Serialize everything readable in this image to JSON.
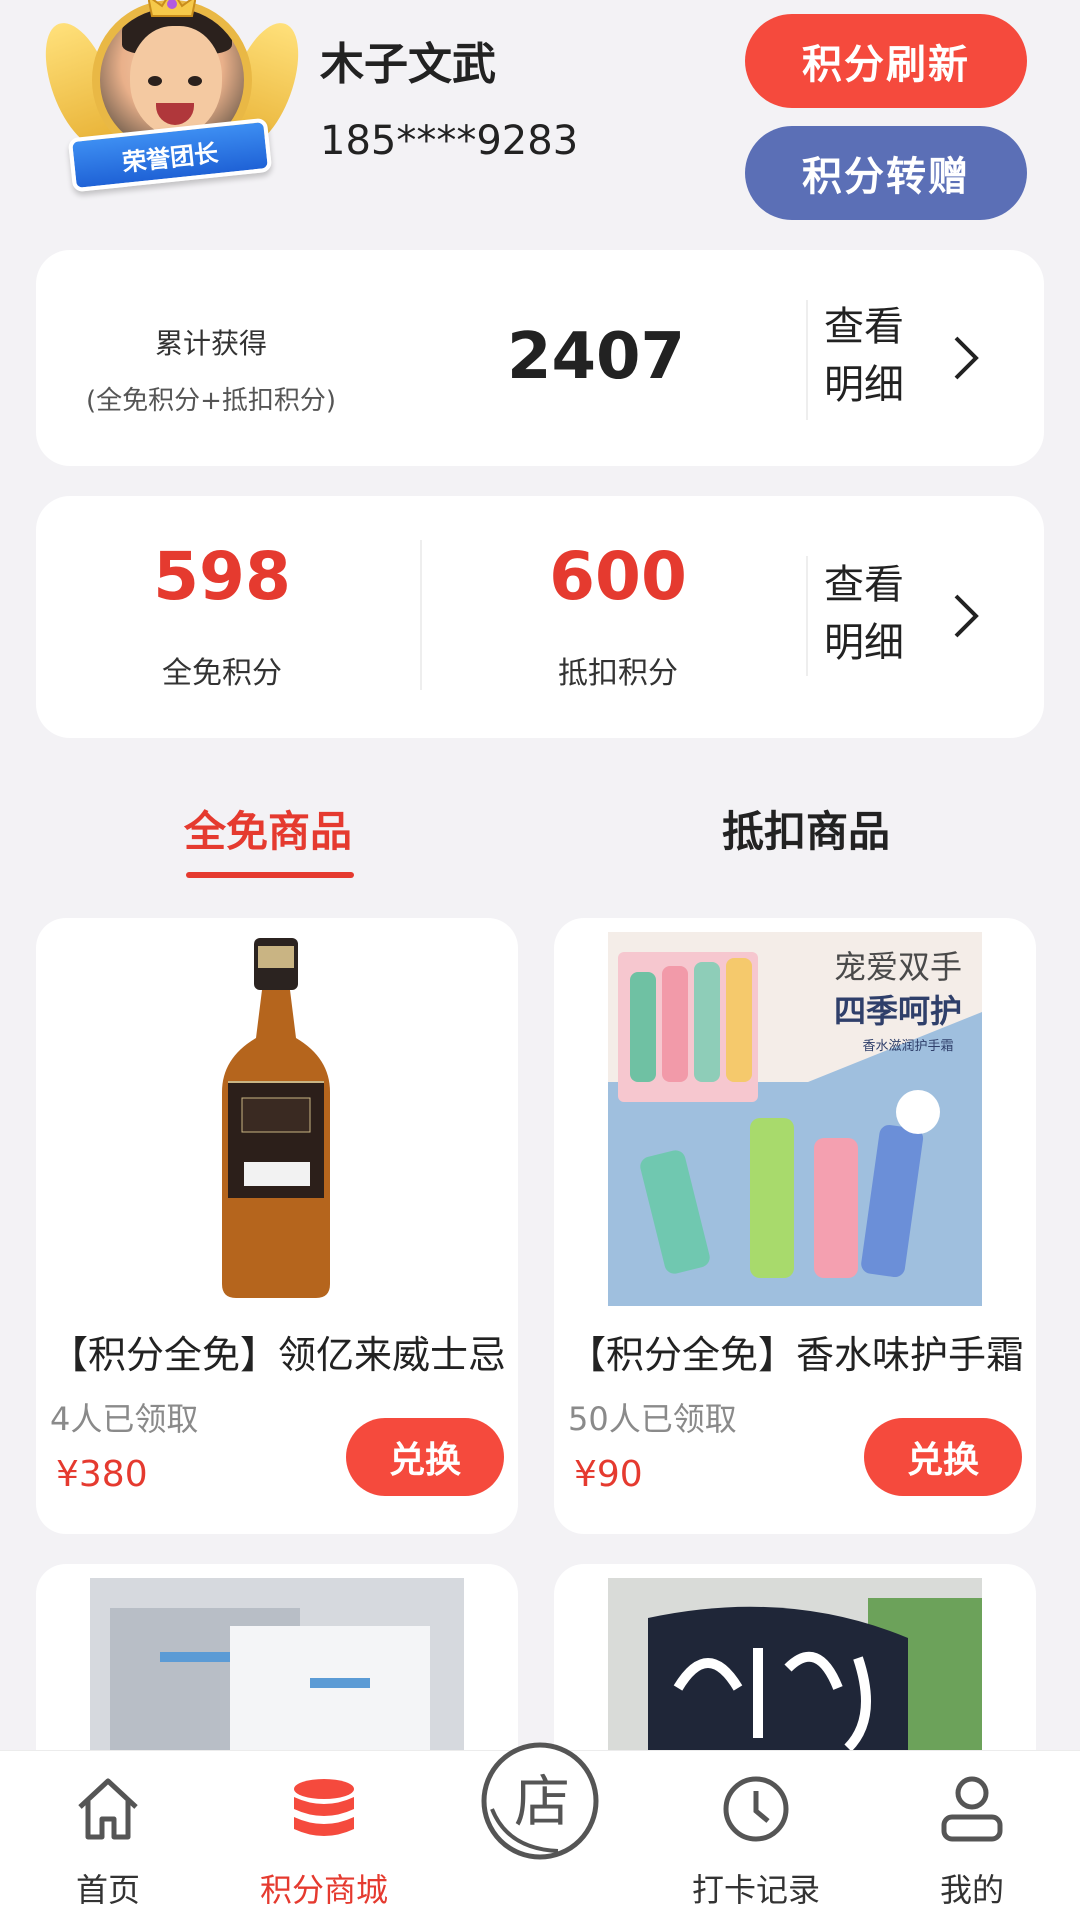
{
  "profile": {
    "badge": "荣誉团长",
    "name": "木子文武",
    "phone": "185****9283"
  },
  "actions": {
    "refresh_label": "积分刷新",
    "transfer_label": "积分转赠"
  },
  "total_card": {
    "label": "累计获得",
    "sub_label": "(全免积分+抵扣积分)",
    "value": "2407",
    "detail_label": "查看明细"
  },
  "points_card": {
    "free_value": "598",
    "free_label": "全免积分",
    "deduct_value": "600",
    "deduct_label": "抵扣积分",
    "detail_label": "查看明细"
  },
  "tabs": [
    {
      "label": "全免商品",
      "active": true
    },
    {
      "label": "抵扣商品",
      "active": false
    }
  ],
  "products": [
    {
      "name": "【积分全免】领亿来威士忌",
      "claimed": "4人已领取",
      "price": "¥380",
      "action": "兑换"
    },
    {
      "name": "【积分全免】香水味护手霜",
      "claimed": "50人已领取",
      "price": "¥90",
      "action": "兑换"
    }
  ],
  "product_images": {
    "hand_cream_title": "宠爱双手",
    "hand_cream_subtitle": "四季呵护",
    "hand_cream_caption": "香水滋润护手霜"
  },
  "nav": [
    {
      "label": "首页",
      "icon": "home-icon",
      "active": false
    },
    {
      "label": "积分商城",
      "icon": "database-icon",
      "active": true
    },
    {
      "label": "店",
      "icon": "store-icon",
      "active": false
    },
    {
      "label": "打卡记录",
      "icon": "clock-icon",
      "active": false
    },
    {
      "label": "我的",
      "icon": "user-icon",
      "active": false
    }
  ],
  "colors": {
    "accent_red": "#e53a2f",
    "button_red": "#f54a3d",
    "button_blue": "#5b6fb6",
    "background": "#f3f2f5"
  }
}
